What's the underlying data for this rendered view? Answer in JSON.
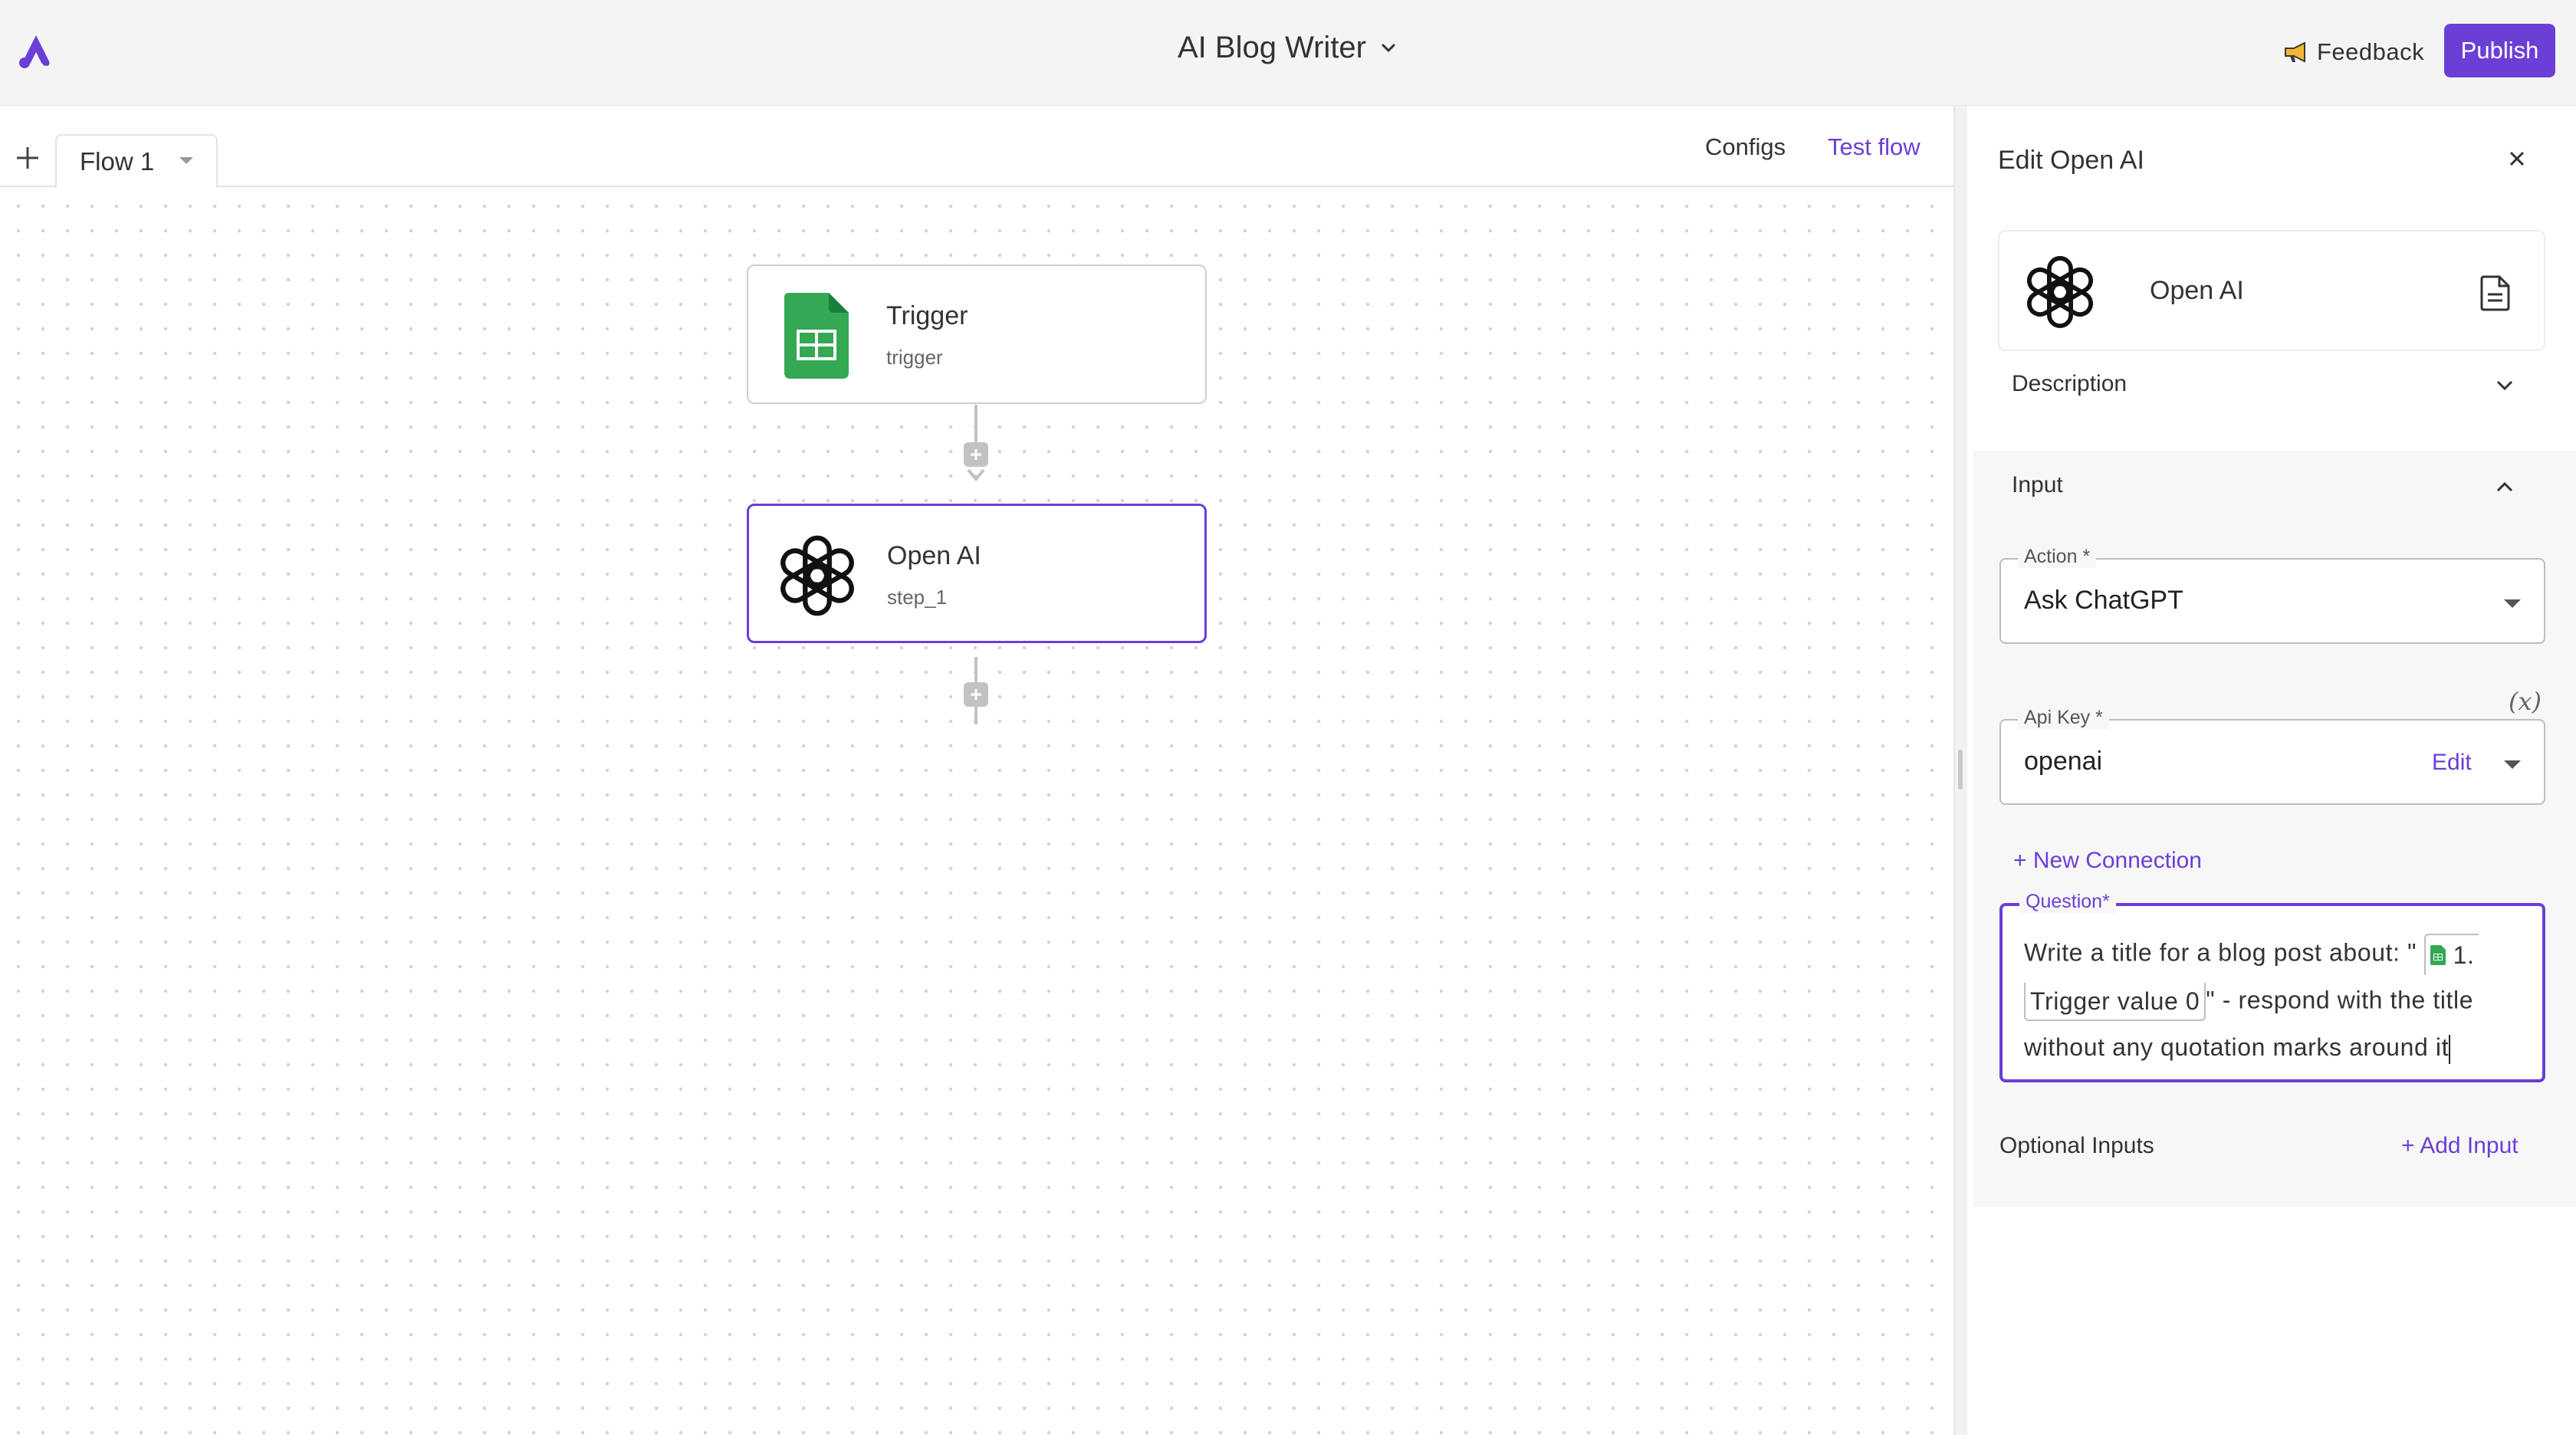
{
  "header": {
    "app_title": "AI Blog Writer",
    "feedback_label": "Feedback",
    "publish_label": "Publish"
  },
  "tabs": {
    "flows": [
      {
        "label": "Flow 1"
      }
    ],
    "configs_label": "Configs",
    "test_flow_label": "Test flow"
  },
  "canvas": {
    "nodes": [
      {
        "title": "Trigger",
        "subtitle": "trigger",
        "icon": "google-sheets-icon"
      },
      {
        "title": "Open AI",
        "subtitle": "step_1",
        "icon": "openai-icon",
        "selected": true
      }
    ]
  },
  "panel": {
    "title": "Edit Open AI",
    "piece_name": "Open AI",
    "description_label": "Description",
    "input_label": "Input",
    "action": {
      "label": "Action *",
      "value": "Ask ChatGPT"
    },
    "api_key": {
      "label": "Api Key *",
      "value": "openai",
      "edit_label": "Edit"
    },
    "variable_icon": "(x)",
    "new_connection_label": "+ New Connection",
    "question": {
      "label": "Question*",
      "line1": "Write a title for a blog post about: \"",
      "chip_part1": "1.",
      "chip_part2": "Trigger value 0",
      "line2_rest": "\" - respond with the title",
      "line3": "without any quotation marks around it"
    },
    "optional_inputs_label": "Optional Inputs",
    "add_input_label": "+ Add Input"
  },
  "colors": {
    "accent": "#6b3fd6",
    "sheets_green": "#34a853"
  }
}
